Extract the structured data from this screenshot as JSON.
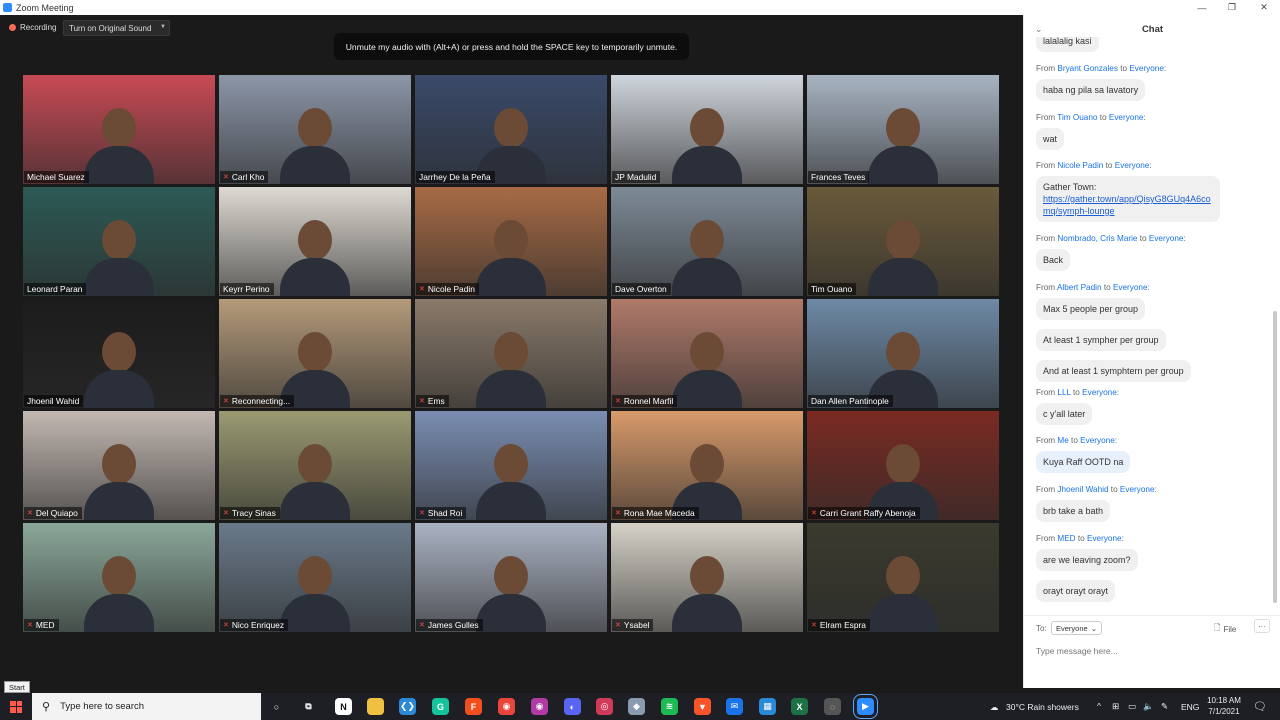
{
  "window": {
    "title": "Zoom Meeting"
  },
  "toolbar": {
    "recording_label": "Recording",
    "original_sound_label": "Turn on Original Sound"
  },
  "notification": "Unmute my audio with (Alt+A) or press and hold the SPACE key to temporarily unmute.",
  "participants": [
    {
      "name": "Michael Suarez",
      "muted": false,
      "bg": "#c84a55",
      "active": false
    },
    {
      "name": "Carl Kho",
      "muted": true,
      "bg": "#8c96a8",
      "active": true
    },
    {
      "name": "Jarrhey De la Peña",
      "muted": false,
      "bg": "#3a4a6a",
      "active": false
    },
    {
      "name": "JP Madulid",
      "muted": false,
      "bg": "#cfd5dc",
      "active": false
    },
    {
      "name": "Frances Teves",
      "muted": false,
      "bg": "#a8b4c2",
      "active": false
    },
    {
      "name": "Leonard Paran",
      "muted": false,
      "bg": "#2d5a55",
      "active": false
    },
    {
      "name": "Keyrr Perino",
      "muted": false,
      "bg": "#dedad3",
      "active": false
    },
    {
      "name": "Nicole Padin",
      "muted": true,
      "bg": "#a86b45",
      "active": false
    },
    {
      "name": "Dave Overton",
      "muted": false,
      "bg": "#7d8a96",
      "active": false
    },
    {
      "name": "Tim Ouano",
      "muted": false,
      "bg": "#6a5a3a",
      "active": false
    },
    {
      "name": "Jhoenil Wahid",
      "muted": false,
      "bg": "#1c1c1c",
      "active": false
    },
    {
      "name": "Reconnecting...",
      "muted": true,
      "bg": "#b49a7a",
      "active": false
    },
    {
      "name": "Ems",
      "muted": true,
      "bg": "#8a7a6a",
      "active": false
    },
    {
      "name": "Ronnel Marfil",
      "muted": true,
      "bg": "#b07a6a",
      "active": false
    },
    {
      "name": "Dan Allen Pantinople",
      "muted": false,
      "bg": "#6e8aa6",
      "active": false
    },
    {
      "name": "Del Quiapo",
      "muted": true,
      "bg": "#c2b8b2",
      "active": false
    },
    {
      "name": "Tracy Sinas",
      "muted": true,
      "bg": "#9a9a72",
      "active": false
    },
    {
      "name": "Shad Roi",
      "muted": true,
      "bg": "#7a8eb2",
      "active": false
    },
    {
      "name": "Rona Mae Maceda",
      "muted": true,
      "bg": "#d89a6a",
      "active": false
    },
    {
      "name": "Carri Grant Raffy Abenoja",
      "muted": true,
      "bg": "#7a2a22",
      "active": false
    },
    {
      "name": "MED",
      "muted": true,
      "bg": "#8aa89a",
      "active": false
    },
    {
      "name": "Nico Enriquez",
      "muted": true,
      "bg": "#6a7a8a",
      "active": false
    },
    {
      "name": "James Gulles",
      "muted": true,
      "bg": "#aab2c2",
      "active": false
    },
    {
      "name": "Ysabel",
      "muted": true,
      "bg": "#d6d2c8",
      "active": false
    },
    {
      "name": "Elram Espra",
      "muted": true,
      "bg": "#3a3a2e",
      "active": false
    }
  ],
  "chat": {
    "title": "Chat",
    "partial_top": "lalalalig kasi",
    "messages": [
      {
        "from": "Bryant Gonzales",
        "to": "Everyone",
        "texts": [
          "haba ng pila sa lavatory"
        ]
      },
      {
        "from": "Tim Ouano",
        "to": "Everyone",
        "texts": [
          "wat"
        ]
      },
      {
        "from": "Nicole Padin",
        "to": "Everyone",
        "texts": [
          "Gather Town:"
        ],
        "link": "https://gather.town/app/QisyG8GUq4A6comq/symph-lounge"
      },
      {
        "from": "Nombrado, Cris Marie",
        "to": "Everyone",
        "texts": [
          "Back"
        ]
      },
      {
        "from": "Albert Padin",
        "to": "Everyone",
        "texts": [
          "Max 5 people per group",
          "At least 1 sympher per group",
          "And at least 1 symphtern per group"
        ]
      },
      {
        "from": "LLL",
        "to": "Everyone",
        "texts": [
          "c y'all later"
        ]
      },
      {
        "from": "Me",
        "to": "Everyone",
        "texts": [
          "Kuya Raff OOTD na"
        ],
        "mine": true
      },
      {
        "from": "Jhoenil Wahid",
        "to": "Everyone",
        "texts": [
          "brb take a bath"
        ]
      },
      {
        "from": "MED",
        "to": "Everyone",
        "texts": [
          "are we leaving zoom?",
          "orayt orayt orayt"
        ]
      }
    ],
    "labels": {
      "from": "From",
      "to": "to"
    },
    "to_label": "To:",
    "to_value": "Everyone",
    "file_label": "File",
    "input_placeholder": "Type message here..."
  },
  "taskbar": {
    "start_tooltip": "Start",
    "search_placeholder": "Type here to search",
    "weather": "30°C  Rain showers",
    "lang": "ENG",
    "time": "10:18 AM",
    "date": "7/1/2021",
    "apps": [
      {
        "name": "cortana",
        "color": "#1e1f24",
        "glyph": "○"
      },
      {
        "name": "task-view",
        "color": "#1e1f24",
        "glyph": "⧉"
      },
      {
        "name": "notion",
        "color": "#ffffff",
        "glyph": "N"
      },
      {
        "name": "file-explorer",
        "color": "#f0c040",
        "glyph": ""
      },
      {
        "name": "vscode",
        "color": "#2a8ad8",
        "glyph": "❮❯"
      },
      {
        "name": "grammarly",
        "color": "#15c39a",
        "glyph": "G"
      },
      {
        "name": "figma",
        "color": "#f24e1e",
        "glyph": "F"
      },
      {
        "name": "chrome",
        "color": "#e8453c",
        "glyph": "◉"
      },
      {
        "name": "chrome-profile",
        "color": "#b03aa6",
        "glyph": "◉"
      },
      {
        "name": "discord",
        "color": "#5865f2",
        "glyph": "◐"
      },
      {
        "name": "app",
        "color": "#d23a5a",
        "glyph": "◎"
      },
      {
        "name": "app2",
        "color": "#8a9bb0",
        "glyph": "◆"
      },
      {
        "name": "spotify",
        "color": "#1db954",
        "glyph": "≋"
      },
      {
        "name": "brave",
        "color": "#fb542b",
        "glyph": "▼"
      },
      {
        "name": "mail",
        "color": "#1a73e8",
        "glyph": "✉"
      },
      {
        "name": "calendar",
        "color": "#2a8ad8",
        "glyph": "▦"
      },
      {
        "name": "excel",
        "color": "#1e7145",
        "glyph": "X"
      },
      {
        "name": "app3",
        "color": "#555555",
        "glyph": "◌"
      },
      {
        "name": "zoom",
        "color": "#2d8cff",
        "glyph": "▶"
      }
    ]
  }
}
